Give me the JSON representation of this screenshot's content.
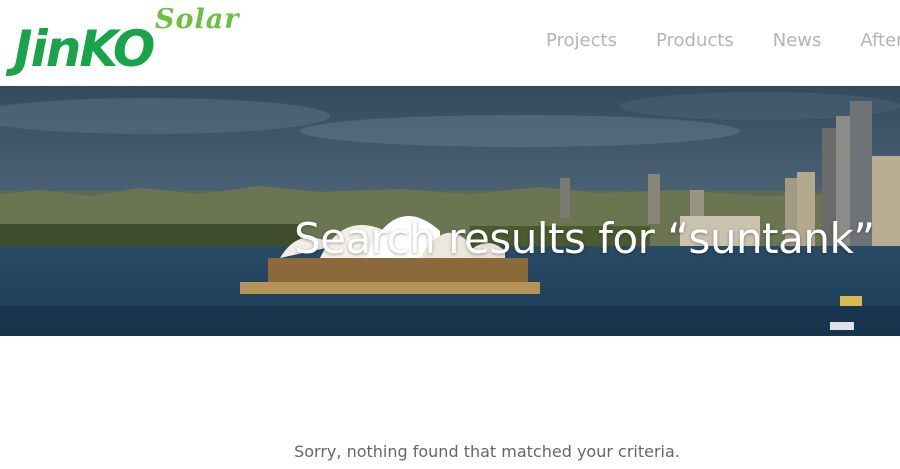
{
  "brand": {
    "logo_main": "JinKO",
    "logo_sub": "Solar"
  },
  "nav": {
    "items": [
      {
        "label": "Projects"
      },
      {
        "label": "Products"
      },
      {
        "label": "News"
      },
      {
        "label": "After"
      }
    ]
  },
  "hero": {
    "title": "Search results for “suntank”"
  },
  "content": {
    "no_results_message": "Sorry, nothing found that matched your criteria."
  },
  "colors": {
    "brand_green": "#19a34a",
    "brand_light_green": "#6cbf3f",
    "nav_text": "#b4b4b4",
    "body_text": "#666666"
  }
}
